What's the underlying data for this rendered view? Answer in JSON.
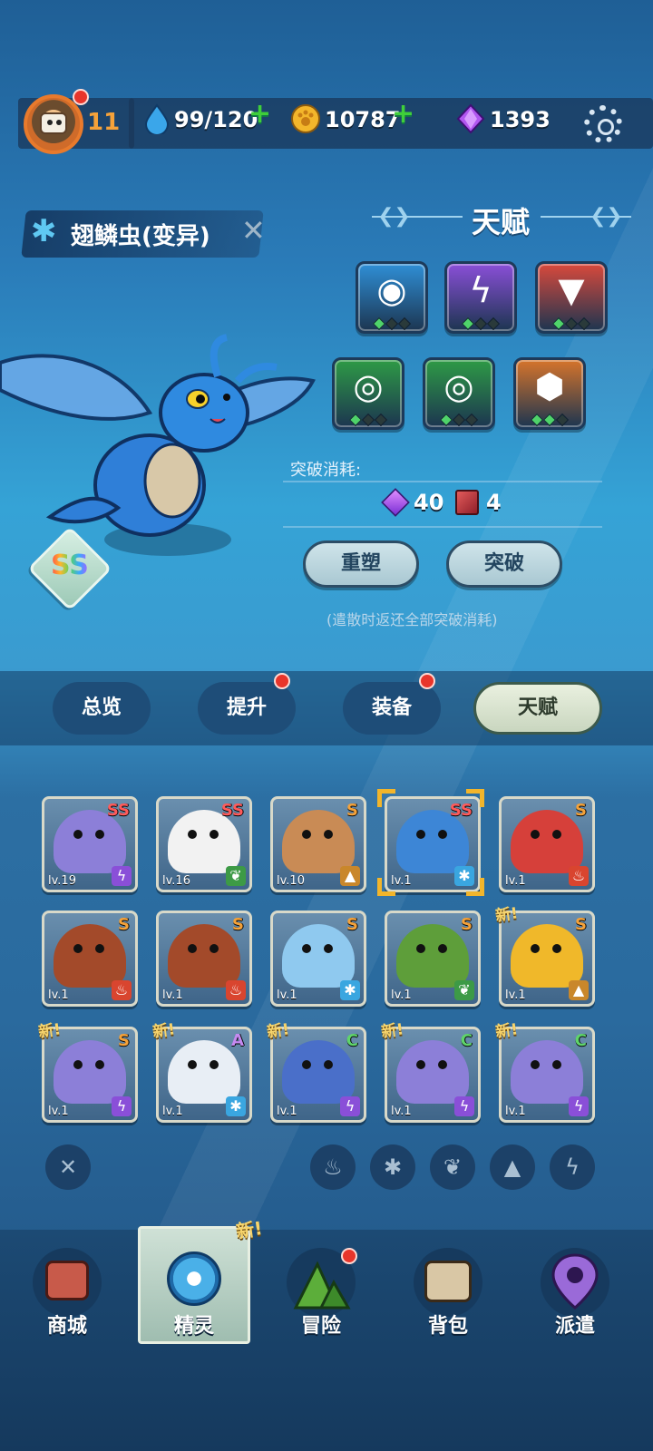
{
  "header": {
    "level": "11",
    "stamina": "99/120",
    "coins": "10787",
    "gems": "1393"
  },
  "pet": {
    "name": "翅鳞虫(变异)",
    "rank": "SS"
  },
  "talent": {
    "title": "天赋",
    "skills": [
      {
        "icon": "eye-icon",
        "color": "#2f8fd6",
        "gems": [
          "green",
          "dark",
          "dark"
        ]
      },
      {
        "icon": "lightning-icon",
        "color": "#8a4fd8",
        "gems": [
          "green",
          "dark",
          "dark"
        ]
      },
      {
        "icon": "fang-icon",
        "color": "#d8493c",
        "gems": [
          "green",
          "dark",
          "dark"
        ]
      },
      {
        "icon": "swirl-icon",
        "color": "#2e9a46",
        "gems": [
          "green",
          "dark",
          "dark"
        ]
      },
      {
        "icon": "swirl-icon",
        "color": "#2e9a46",
        "gems": [
          "green",
          "dark",
          "dark"
        ]
      },
      {
        "icon": "hexagon-icon",
        "color": "#d6742b",
        "gems": [
          "green",
          "green",
          "dark"
        ]
      }
    ],
    "break_label": "突破消耗:",
    "cost_gems": "40",
    "cost_books": "4",
    "reset_button": "重塑",
    "break_button": "突破",
    "hint": "(遣散时返还全部突破消耗)"
  },
  "tabs": [
    {
      "label": "总览",
      "dot": false
    },
    {
      "label": "提升",
      "dot": true
    },
    {
      "label": "装备",
      "dot": true
    },
    {
      "label": "天赋",
      "dot": false,
      "active": true
    }
  ],
  "pets": [
    {
      "rank": "SS",
      "lv": "lv.19",
      "elem": "lightning",
      "art": "#8c7fd8",
      "new": false
    },
    {
      "rank": "SS",
      "lv": "lv.16",
      "elem": "leaf",
      "art": "#f2f2f2",
      "new": false
    },
    {
      "rank": "S",
      "lv": "lv.10",
      "elem": "earth",
      "art": "#c98b55",
      "new": false
    },
    {
      "rank": "SS",
      "lv": "lv.1",
      "elem": "ice",
      "art": "#3d86d6",
      "new": false,
      "selected": true
    },
    {
      "rank": "S",
      "lv": "lv.1",
      "elem": "fire",
      "art": "#d6403a",
      "new": false
    },
    {
      "rank": "S",
      "lv": "lv.1",
      "elem": "fire",
      "art": "#a34a2a",
      "new": false
    },
    {
      "rank": "S",
      "lv": "lv.1",
      "elem": "fire",
      "art": "#a34a2a",
      "new": false
    },
    {
      "rank": "S",
      "lv": "lv.1",
      "elem": "ice",
      "art": "#8fc9ef",
      "new": false
    },
    {
      "rank": "S",
      "lv": "lv.1",
      "elem": "leaf",
      "art": "#5e9e3a",
      "new": false
    },
    {
      "rank": "S",
      "lv": "lv.1",
      "elem": "earth",
      "art": "#f0b82a",
      "new": true
    },
    {
      "rank": "S",
      "lv": "lv.1",
      "elem": "lightning",
      "art": "#8c7fd8",
      "new": true
    },
    {
      "rank": "A",
      "lv": "lv.1",
      "elem": "ice",
      "art": "#e8eef5",
      "new": true
    },
    {
      "rank": "C",
      "lv": "lv.1",
      "elem": "lightning",
      "art": "#4a6fc9",
      "new": true
    },
    {
      "rank": "C",
      "lv": "lv.1",
      "elem": "lightning",
      "art": "#8c7fd8",
      "new": true
    },
    {
      "rank": "C",
      "lv": "lv.1",
      "elem": "lightning",
      "art": "#8c7fd8",
      "new": true
    }
  ],
  "new_label": "新!",
  "filters": [
    "close-icon",
    "fire-icon",
    "ice-icon",
    "leaf-icon",
    "earth-icon",
    "lightning-icon"
  ],
  "nav": [
    {
      "label": "商城",
      "icon": "shop-icon"
    },
    {
      "label": "精灵",
      "icon": "spirit-icon",
      "active": true,
      "new": true
    },
    {
      "label": "冒险",
      "icon": "mountain-icon",
      "dot": true
    },
    {
      "label": "背包",
      "icon": "backpack-icon"
    },
    {
      "label": "派遣",
      "icon": "location-icon"
    }
  ],
  "colors": {
    "rank_ss": "#ff5b5b",
    "rank_s": "#f5a23a",
    "rank_a": "#c58af0",
    "rank_c": "#5fd46a"
  }
}
